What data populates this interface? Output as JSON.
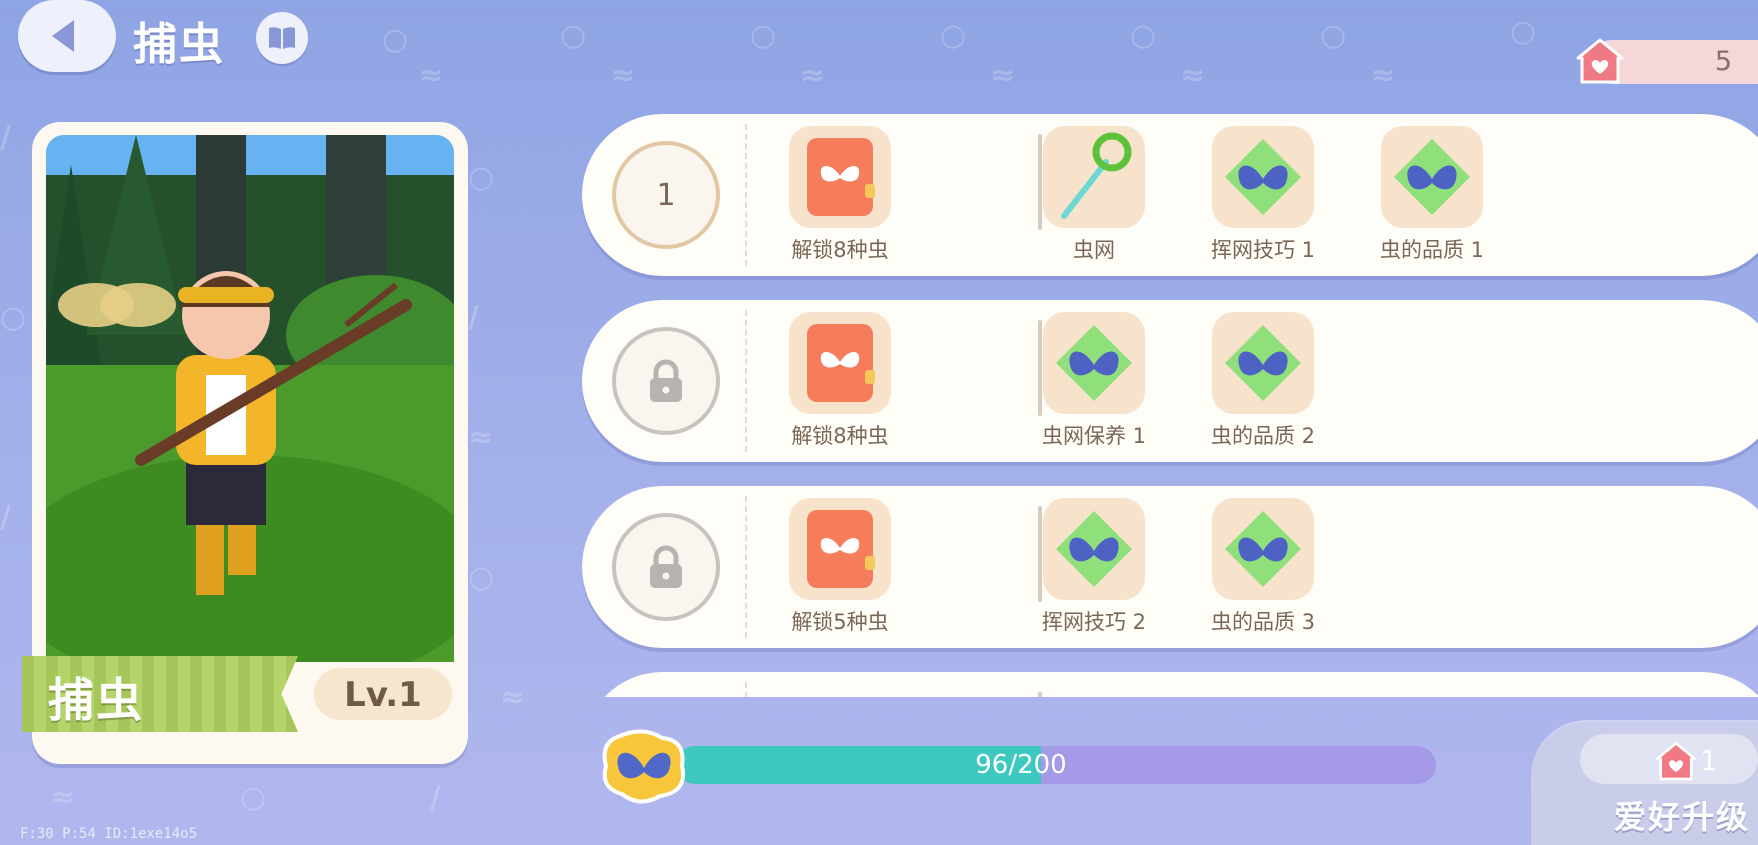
{
  "header": {
    "title": "捕虫"
  },
  "points": {
    "value": "5"
  },
  "character": {
    "name": "捕虫",
    "level": "Lv.1"
  },
  "rows": [
    {
      "status": "unlocked",
      "number": "1",
      "requirement": {
        "label": "解锁8种虫",
        "icon": "butterfly-book-icon"
      },
      "rewards": [
        {
          "label": "虫网",
          "icon": "net-icon"
        },
        {
          "label": "挥网技巧 1",
          "icon": "butterfly-skill-icon"
        },
        {
          "label": "虫的品质 1",
          "icon": "butterfly-skill-icon"
        }
      ]
    },
    {
      "status": "locked",
      "requirement": {
        "label": "解锁8种虫",
        "icon": "butterfly-book-icon"
      },
      "rewards": [
        {
          "label": "虫网保养 1",
          "icon": "butterfly-skill-icon"
        },
        {
          "label": "虫的品质 2",
          "icon": "butterfly-skill-icon"
        }
      ]
    },
    {
      "status": "locked",
      "requirement": {
        "label": "解锁5种虫",
        "icon": "butterfly-book-icon"
      },
      "rewards": [
        {
          "label": "挥网技巧 2",
          "icon": "butterfly-skill-icon"
        },
        {
          "label": "虫的品质 3",
          "icon": "butterfly-skill-icon"
        }
      ]
    }
  ],
  "progress": {
    "text": "96/200",
    "current": 96,
    "max": 200
  },
  "upgrade": {
    "cost": "1",
    "label": "爱好升级"
  },
  "debug": {
    "text": "F:30   P:54   ID:1exe14o5"
  },
  "colors": {
    "progress_fill": "#3ec9c0",
    "progress_track": "#a59ae8",
    "level_ring": "#e2c7a4"
  }
}
